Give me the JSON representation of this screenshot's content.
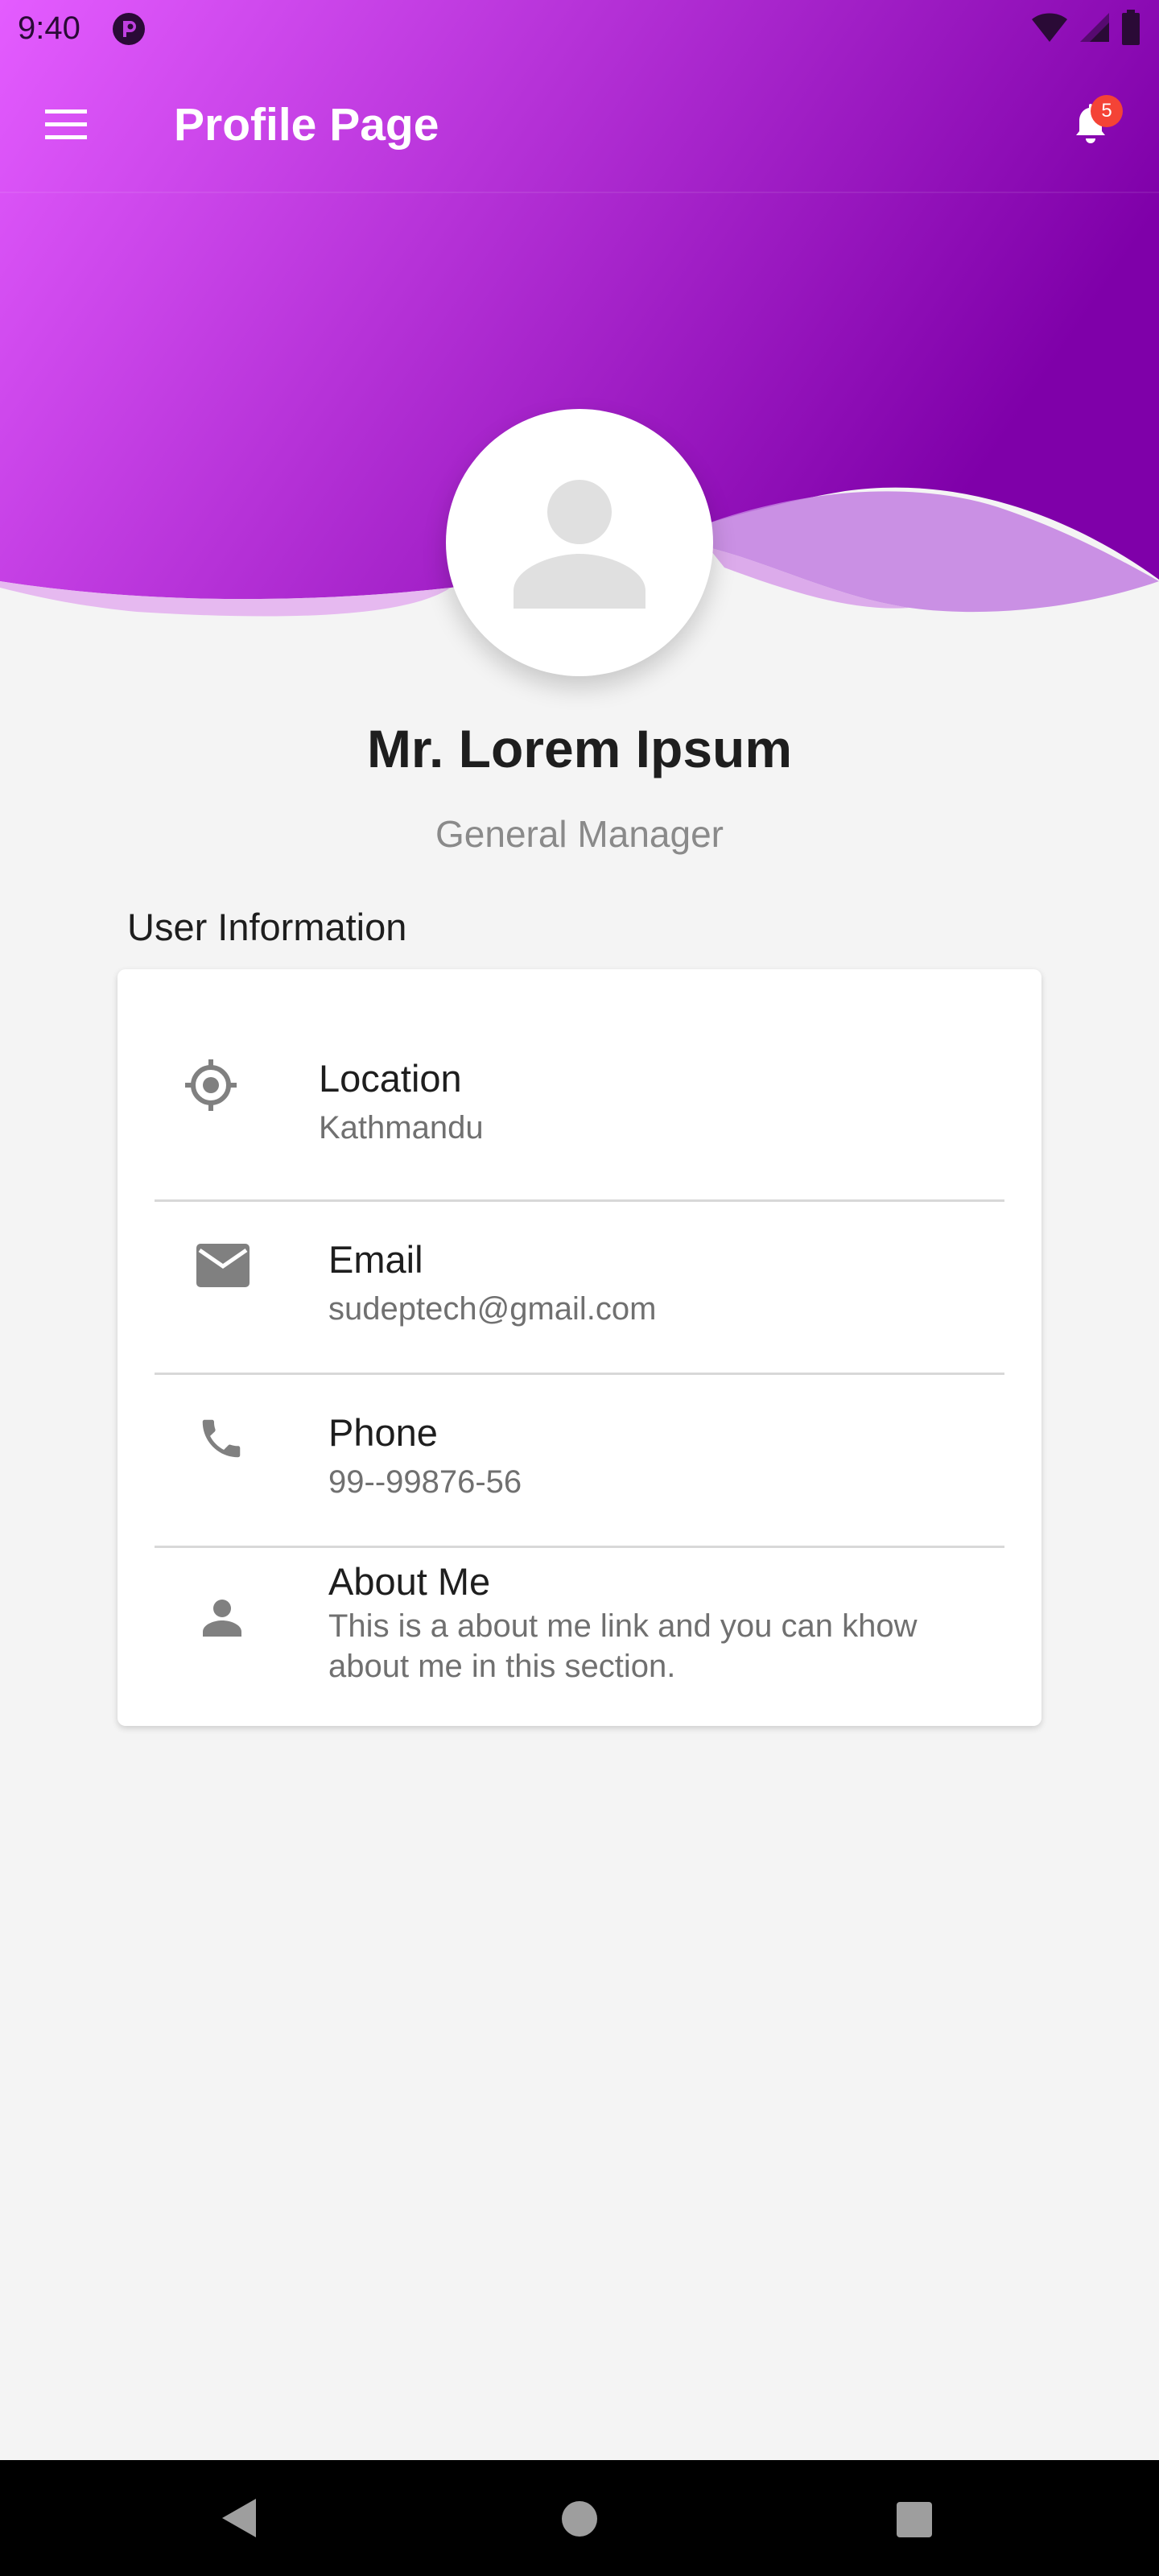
{
  "status_bar": {
    "time": "9:40",
    "icons": [
      "app-notification-icon",
      "wifi-icon",
      "signal-icon",
      "battery-icon"
    ]
  },
  "app_bar": {
    "title": "Profile Page",
    "menu_icon": "menu-icon",
    "notification_icon": "bell-icon",
    "notification_count": "5"
  },
  "colors": {
    "gradient_start": "#e45cff",
    "gradient_end": "#7f00a9",
    "badge": "#f44336",
    "background": "#f4f4f4",
    "icon_grey": "#808080"
  },
  "profile": {
    "avatar_icon": "person-icon",
    "name": "Mr. Lorem Ipsum",
    "role": "General Manager"
  },
  "user_info": {
    "section_title": "User Information",
    "items": [
      {
        "icon": "location-target-icon",
        "label": "Location",
        "value": "Kathmandu"
      },
      {
        "icon": "email-icon",
        "label": "Email",
        "value": "sudeptech@gmail.com"
      },
      {
        "icon": "phone-icon",
        "label": "Phone",
        "value": "99--99876-56"
      },
      {
        "icon": "person-icon",
        "label": "About Me",
        "value": "This is a about me link and you can khow about me in this section."
      }
    ]
  },
  "nav_bar": {
    "buttons": [
      "back-icon",
      "home-icon",
      "recents-icon"
    ]
  }
}
